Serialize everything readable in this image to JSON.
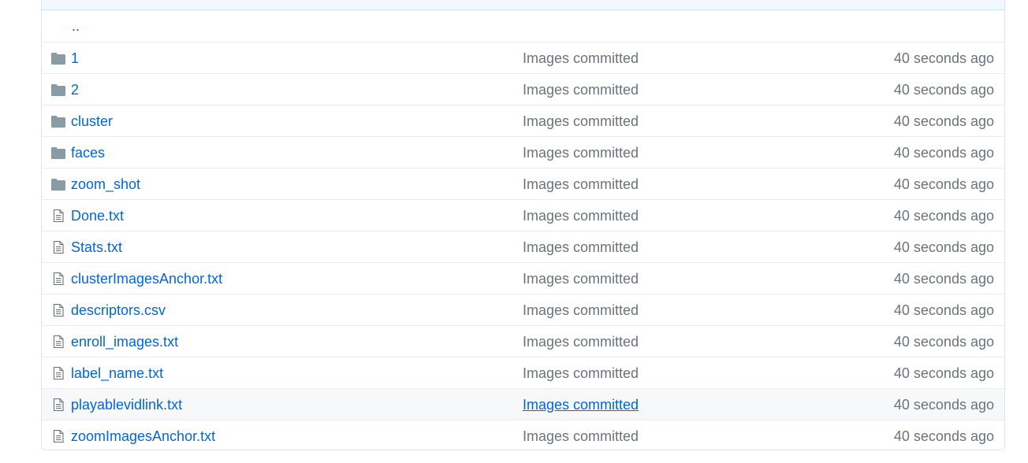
{
  "colors": {
    "link": "#0366d6",
    "muted": "#6a737d",
    "folder_icon": "#79b8ff",
    "file_icon": "#6a737d",
    "border": "#e1e4e8",
    "hover_row": "#f6f8fa"
  },
  "parent": {
    "label": ".."
  },
  "rows": [
    {
      "type": "folder",
      "icon": "folder-icon",
      "name": "1",
      "message": "Images committed",
      "age": "40 seconds ago"
    },
    {
      "type": "folder",
      "icon": "folder-icon",
      "name": "2",
      "message": "Images committed",
      "age": "40 seconds ago"
    },
    {
      "type": "folder",
      "icon": "folder-icon",
      "name": "cluster",
      "message": "Images committed",
      "age": "40 seconds ago"
    },
    {
      "type": "folder",
      "icon": "folder-icon",
      "name": "faces",
      "message": "Images committed",
      "age": "40 seconds ago"
    },
    {
      "type": "folder",
      "icon": "folder-icon",
      "name": "zoom_shot",
      "message": "Images committed",
      "age": "40 seconds ago"
    },
    {
      "type": "file",
      "icon": "file-icon",
      "name": "Done.txt",
      "message": "Images committed",
      "age": "40 seconds ago"
    },
    {
      "type": "file",
      "icon": "file-icon",
      "name": "Stats.txt",
      "message": "Images committed",
      "age": "40 seconds ago"
    },
    {
      "type": "file",
      "icon": "file-icon",
      "name": "clusterImagesAnchor.txt",
      "message": "Images committed",
      "age": "40 seconds ago"
    },
    {
      "type": "file",
      "icon": "file-icon",
      "name": "descriptors.csv",
      "message": "Images committed",
      "age": "40 seconds ago"
    },
    {
      "type": "file",
      "icon": "file-icon",
      "name": "enroll_images.txt",
      "message": "Images committed",
      "age": "40 seconds ago"
    },
    {
      "type": "file",
      "icon": "file-icon",
      "name": "label_name.txt",
      "message": "Images committed",
      "age": "40 seconds ago"
    },
    {
      "type": "file",
      "icon": "file-icon",
      "name": "playablevidlink.txt",
      "message": "Images committed",
      "age": "40 seconds ago",
      "hovered": true
    },
    {
      "type": "file",
      "icon": "file-icon",
      "name": "zoomImagesAnchor.txt",
      "message": "Images committed",
      "age": "40 seconds ago"
    }
  ]
}
